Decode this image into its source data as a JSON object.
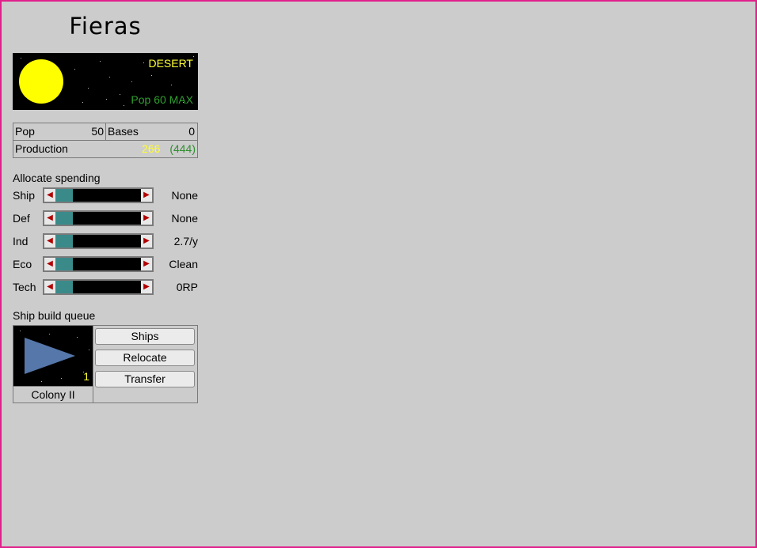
{
  "planet": {
    "name": "Fieras",
    "climate": "DESERT",
    "pop_max": "Pop 60 MAX"
  },
  "stats": {
    "pop_label": "Pop",
    "pop_value": "50",
    "bases_label": "Bases",
    "bases_value": "0",
    "production_label": "Production",
    "production_current": "266",
    "production_max": "(444)"
  },
  "allocation": {
    "header": "Allocate spending",
    "rows": [
      {
        "label": "Ship",
        "value": "None",
        "level": 0.2
      },
      {
        "label": "Def",
        "value": "None",
        "level": 0.2
      },
      {
        "label": "Ind",
        "value": "2.7/y",
        "level": 0.2
      },
      {
        "label": "Eco",
        "value": "Clean",
        "level": 0.2
      },
      {
        "label": "Tech",
        "value": "0RP",
        "level": 0.2
      }
    ]
  },
  "queue": {
    "header": "Ship build queue",
    "ship_name": "Colony II",
    "ship_count": "1",
    "buttons": {
      "ships": "Ships",
      "relocate": "Relocate",
      "transfer": "Transfer"
    }
  },
  "colors": {
    "border": "#e0208a",
    "climate": "#ffff33",
    "pop_max": "#2fa02f",
    "slider_fill": "#3a8a8a",
    "ship": "#5577aa"
  },
  "icons": {
    "slider_left": "left-arrow-icon",
    "slider_right": "right-arrow-icon",
    "sun": "sun-icon",
    "ship": "ship-icon"
  }
}
